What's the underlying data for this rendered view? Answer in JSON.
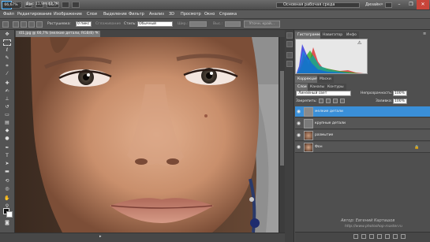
{
  "app": {
    "logo": "Ps",
    "app_icons": [
      "Br",
      "Mb"
    ],
    "zoom_preset": "66,7",
    "workspace": "Основная рабочая среда",
    "workspace_label": "Дизайн",
    "window_buttons": [
      "–",
      "❐",
      "✕"
    ]
  },
  "menu": [
    "Файл",
    "Редактирование",
    "Изображение",
    "Слои",
    "Выделение",
    "Фильтр",
    "Анализ",
    "3D",
    "Просмотр",
    "Окно",
    "Справка"
  ],
  "options": {
    "feather_label": "Растушевка:",
    "feather_value": "0 пикс",
    "antialias_label": "Сглаживание",
    "style_label": "Стиль:",
    "style_value": "Обычный",
    "width_label": "Шир.:",
    "height_label": "Выс.:",
    "refine_button": "Уточн. край..."
  },
  "document": {
    "tab_title": "i01.jpg @ 66,7% (мелкие детали, RGB/8) *",
    "zoom": "66,67%",
    "doc_size": "Док: 11,9M/47,7M"
  },
  "panels": {
    "tabs_top": [
      "Гистограмма",
      "Навигатор",
      "Инфо"
    ],
    "tabs_adjust": [
      "Коррекция",
      "Маски"
    ],
    "tabs_layers": [
      "Слои",
      "Каналы",
      "Контуры"
    ],
    "blend_mode": "Линейный свет",
    "opacity_label": "Непрозрачность:",
    "opacity_value": "100%",
    "lock_label": "Закрепить:",
    "fill_label": "Заливка:",
    "fill_value": "100%",
    "layers": [
      {
        "name": "мелкие детали",
        "selected": true
      },
      {
        "name": "крупные детали",
        "selected": false
      },
      {
        "name": "размытие",
        "selected": false
      },
      {
        "name": "Фон",
        "selected": false
      }
    ]
  },
  "watermark": {
    "line1": "Автор: Евгений Карташов",
    "line2": "http://www.photoshop-master.ru"
  },
  "colors": {
    "selection": "#3a8fd8",
    "panel_bg": "#4f4f4f",
    "chrome_bg": "#535353"
  }
}
